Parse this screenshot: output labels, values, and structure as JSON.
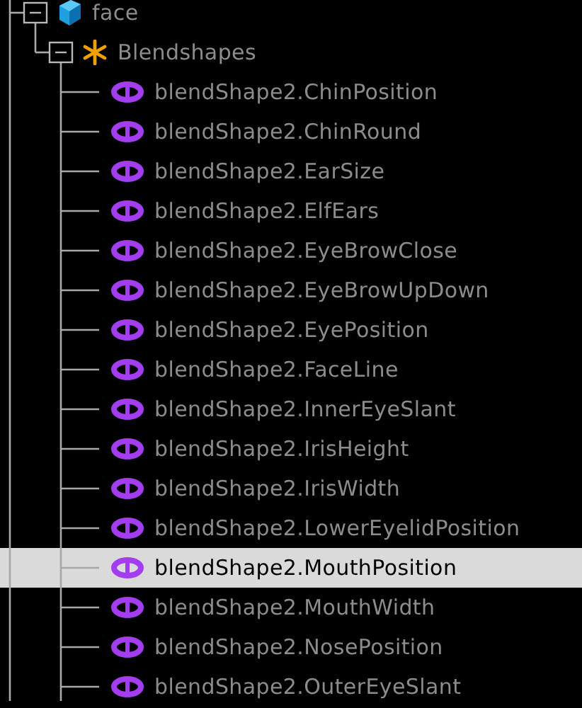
{
  "tree": [
    {
      "label": "face",
      "kind": "mesh",
      "expanded": true,
      "selected": false,
      "children": [
        {
          "label": "Blendshapes",
          "kind": "deformer",
          "expanded": true,
          "selected": false,
          "children": [
            {
              "label": "blendShape2.ChinPosition",
              "kind": "target",
              "selected": false
            },
            {
              "label": "blendShape2.ChinRound",
              "kind": "target",
              "selected": false
            },
            {
              "label": "blendShape2.EarSize",
              "kind": "target",
              "selected": false
            },
            {
              "label": "blendShape2.ElfEars",
              "kind": "target",
              "selected": false
            },
            {
              "label": "blendShape2.EyeBrowClose",
              "kind": "target",
              "selected": false
            },
            {
              "label": "blendShape2.EyeBrowUpDown",
              "kind": "target",
              "selected": false
            },
            {
              "label": "blendShape2.EyePosition",
              "kind": "target",
              "selected": false
            },
            {
              "label": "blendShape2.FaceLine",
              "kind": "target",
              "selected": false
            },
            {
              "label": "blendShape2.InnerEyeSlant",
              "kind": "target",
              "selected": false
            },
            {
              "label": "blendShape2.IrisHeight",
              "kind": "target",
              "selected": false
            },
            {
              "label": "blendShape2.IrisWidth",
              "kind": "target",
              "selected": false
            },
            {
              "label": "blendShape2.LowerEyelidPosition",
              "kind": "target",
              "selected": false
            },
            {
              "label": "blendShape2.MouthPosition",
              "kind": "target",
              "selected": true
            },
            {
              "label": "blendShape2.MouthWidth",
              "kind": "target",
              "selected": false
            },
            {
              "label": "blendShape2.NosePosition",
              "kind": "target",
              "selected": false
            },
            {
              "label": "blendShape2.OuterEyeSlant",
              "kind": "target",
              "selected": false
            }
          ]
        }
      ]
    }
  ]
}
